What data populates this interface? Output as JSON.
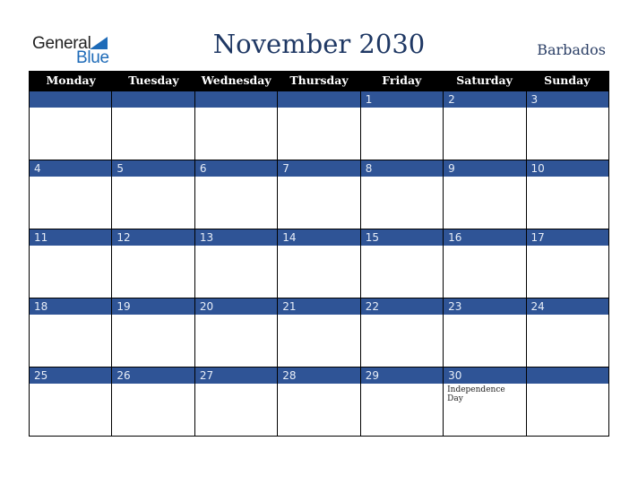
{
  "logo": {
    "general": "General",
    "blue": "Blue"
  },
  "header": {
    "title": "November 2030",
    "country": "Barbados"
  },
  "colors": {
    "strip": "#2f5496",
    "title": "#1f3864",
    "header_bg": "#000000"
  },
  "weekdays": [
    "Monday",
    "Tuesday",
    "Wednesday",
    "Thursday",
    "Friday",
    "Saturday",
    "Sunday"
  ],
  "weeks": [
    {
      "days": [
        "",
        "",
        "",
        "",
        "1",
        "2",
        "3"
      ],
      "events": [
        "",
        "",
        "",
        "",
        "",
        "",
        ""
      ]
    },
    {
      "days": [
        "4",
        "5",
        "6",
        "7",
        "8",
        "9",
        "10"
      ],
      "events": [
        "",
        "",
        "",
        "",
        "",
        "",
        ""
      ]
    },
    {
      "days": [
        "11",
        "12",
        "13",
        "14",
        "15",
        "16",
        "17"
      ],
      "events": [
        "",
        "",
        "",
        "",
        "",
        "",
        ""
      ]
    },
    {
      "days": [
        "18",
        "19",
        "20",
        "21",
        "22",
        "23",
        "24"
      ],
      "events": [
        "",
        "",
        "",
        "",
        "",
        "",
        ""
      ]
    },
    {
      "days": [
        "25",
        "26",
        "27",
        "28",
        "29",
        "30",
        ""
      ],
      "events": [
        "",
        "",
        "",
        "",
        "",
        "Independence Day",
        ""
      ]
    }
  ]
}
